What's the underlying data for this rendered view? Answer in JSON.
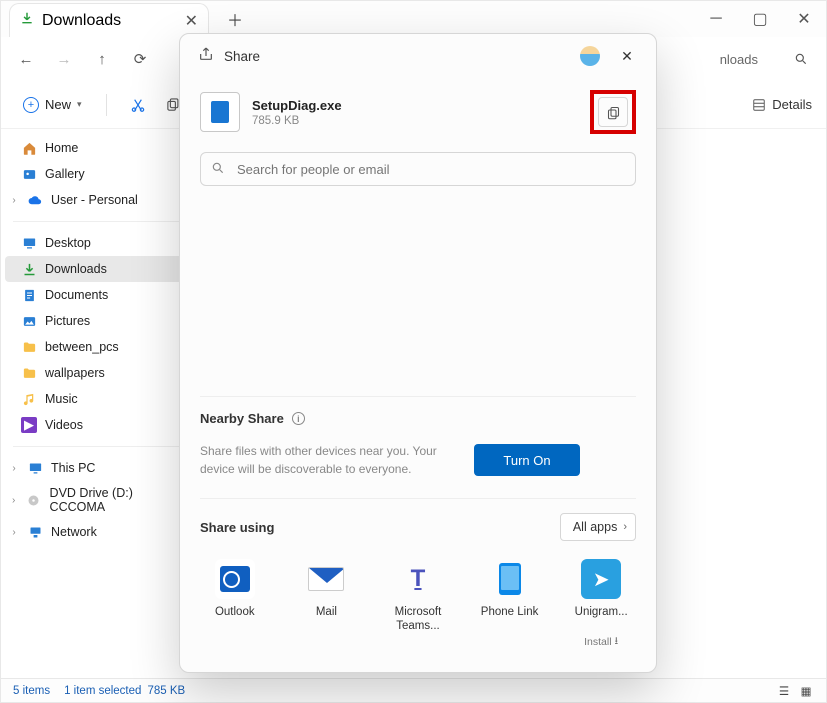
{
  "window": {
    "tab_title": "Downloads",
    "address_hint": "nloads"
  },
  "toolbar": {
    "new_label": "New",
    "details_label": "Details"
  },
  "sidebar": {
    "home": "Home",
    "gallery": "Gallery",
    "user_personal": "User - Personal",
    "desktop": "Desktop",
    "downloads": "Downloads",
    "documents": "Documents",
    "pictures": "Pictures",
    "between_pcs": "between_pcs",
    "wallpapers": "wallpapers",
    "music": "Music",
    "videos": "Videos",
    "this_pc": "This PC",
    "dvd": "DVD Drive (D:) CCCOMA",
    "network": "Network"
  },
  "statusbar": {
    "items": "5 items",
    "selected": "1 item selected",
    "size": "785 KB"
  },
  "share": {
    "title": "Share",
    "file": {
      "name": "SetupDiag.exe",
      "size": "785.9 KB"
    },
    "search_placeholder": "Search for people or email",
    "nearby": {
      "title": "Nearby Share",
      "desc": "Share files with other devices near you. Your device will be discoverable to everyone.",
      "turn_on": "Turn On"
    },
    "share_using_label": "Share using",
    "all_apps_label": "All apps",
    "apps": {
      "outlook": "Outlook",
      "mail": "Mail",
      "teams": "Microsoft Teams...",
      "phonelink": "Phone Link",
      "unigram": "Unigram...",
      "unigram_install": "Install"
    }
  }
}
